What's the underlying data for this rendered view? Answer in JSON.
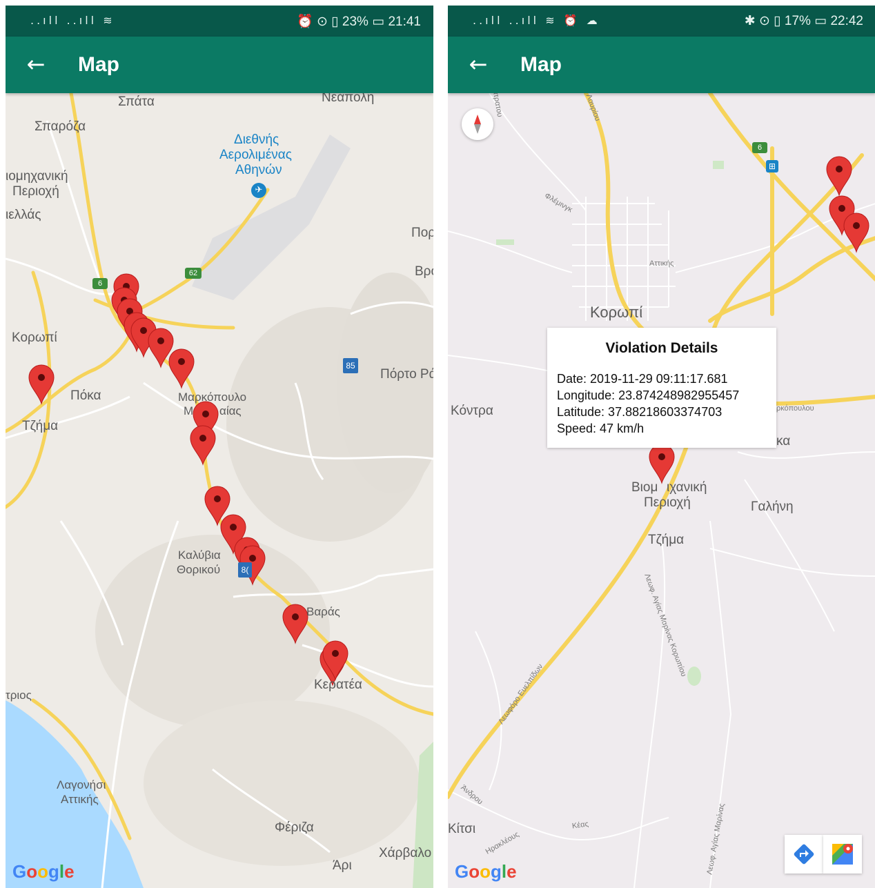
{
  "left": {
    "status": {
      "signal": "..ıll ..ıll ≋",
      "right": "⏰ ⊙ ▯ 23% ▭ 21:41"
    },
    "appbar": {
      "title": "Map",
      "back_icon": "arrow-left-icon"
    },
    "places": {
      "spata": "Σπάτα",
      "neapoli": "Νεάπολη",
      "sparoza": "Σπαρόζα",
      "airport1": "Διεθνής",
      "airport2": "Αερολιμένας",
      "airport3": "Αθηνών",
      "viom1": "ιομηχανική",
      "viom2": "Περιοχή",
      "ellas": "ιελλάς",
      "por": "Πορ",
      "vro": "Βρο",
      "koropi": "Κορωπί",
      "poka": "Πόκα",
      "markopoulo1": "Μαρκόπουλο",
      "markopoulo2": "Μ",
      "markopoulo3": "αίας",
      "tzima": "Τζήμα",
      "portora": "Πόρτο Ρά",
      "kalyvia1": "Καλύβια",
      "kalyvia2": "Θορικού",
      "varas": "Βαράς",
      "keratea": "Κερατέα",
      "trios": "τριος",
      "lagonisi1": "Λαγονήσι",
      "lagonisi2": "Αττικής",
      "feriza": "Φέριζα",
      "xarvalo": "Χάρβαλο",
      "ari": "Άρι"
    },
    "shields": {
      "r6": "6",
      "r62": "62",
      "r85": "85",
      "r8": "8("
    },
    "google": [
      "G",
      "o",
      "o",
      "g",
      "l",
      "e"
    ]
  },
  "right": {
    "status": {
      "signal": "..ıll ..ıll ≋ ⏰ ☁",
      "right": "✱ ⊙ ▯ 17% ▭ 22:42"
    },
    "appbar": {
      "title": "Map",
      "back_icon": "arrow-left-icon"
    },
    "places": {
      "koropi": "Κορωπί",
      "kontra": "Κόντρα",
      "markopoulou": "ρκόπουλου",
      "ka": "κα",
      "viom1": "Βιομ",
      "viom1b": "ιχανική",
      "viom2": "Περιοχή",
      "galini": "Γαλήνη",
      "tzima": "Τζήμα",
      "kitsi": "Κίτσι",
      "lavriou": "Λαυρίου",
      "flemingk": "Φλέμινγκ",
      "attikis": "Αττικής",
      "leof_ag": "Λεωφ. Αγίας Μαρίνας Κορωπίου",
      "leof_ev": "Λεωφόρο Ευελπίδων",
      "androu": "Άνδρου",
      "iraklous": "Ηρακλέους",
      "keas": "Κέας",
      "leof_ag2": "Λεωφ. Αγίας Μαρίνας",
      "top": "ατρατου"
    },
    "shields": {
      "r6": "6"
    },
    "infowindow": {
      "title": "Violation Details",
      "date": "Date: 2019-11-29 09:11:17.681",
      "longitude": "Longitude: 23.874248982955457",
      "latitude": "Latitude: 37.88218603374703",
      "speed": "Speed: 47 km/h"
    },
    "google": [
      "G",
      "o",
      "o",
      "g",
      "l",
      "e"
    ]
  },
  "colors": {
    "status_bar": "#08584a",
    "app_bar": "#0b7a64",
    "marker": "#e53935",
    "road": "#f6d35a"
  }
}
